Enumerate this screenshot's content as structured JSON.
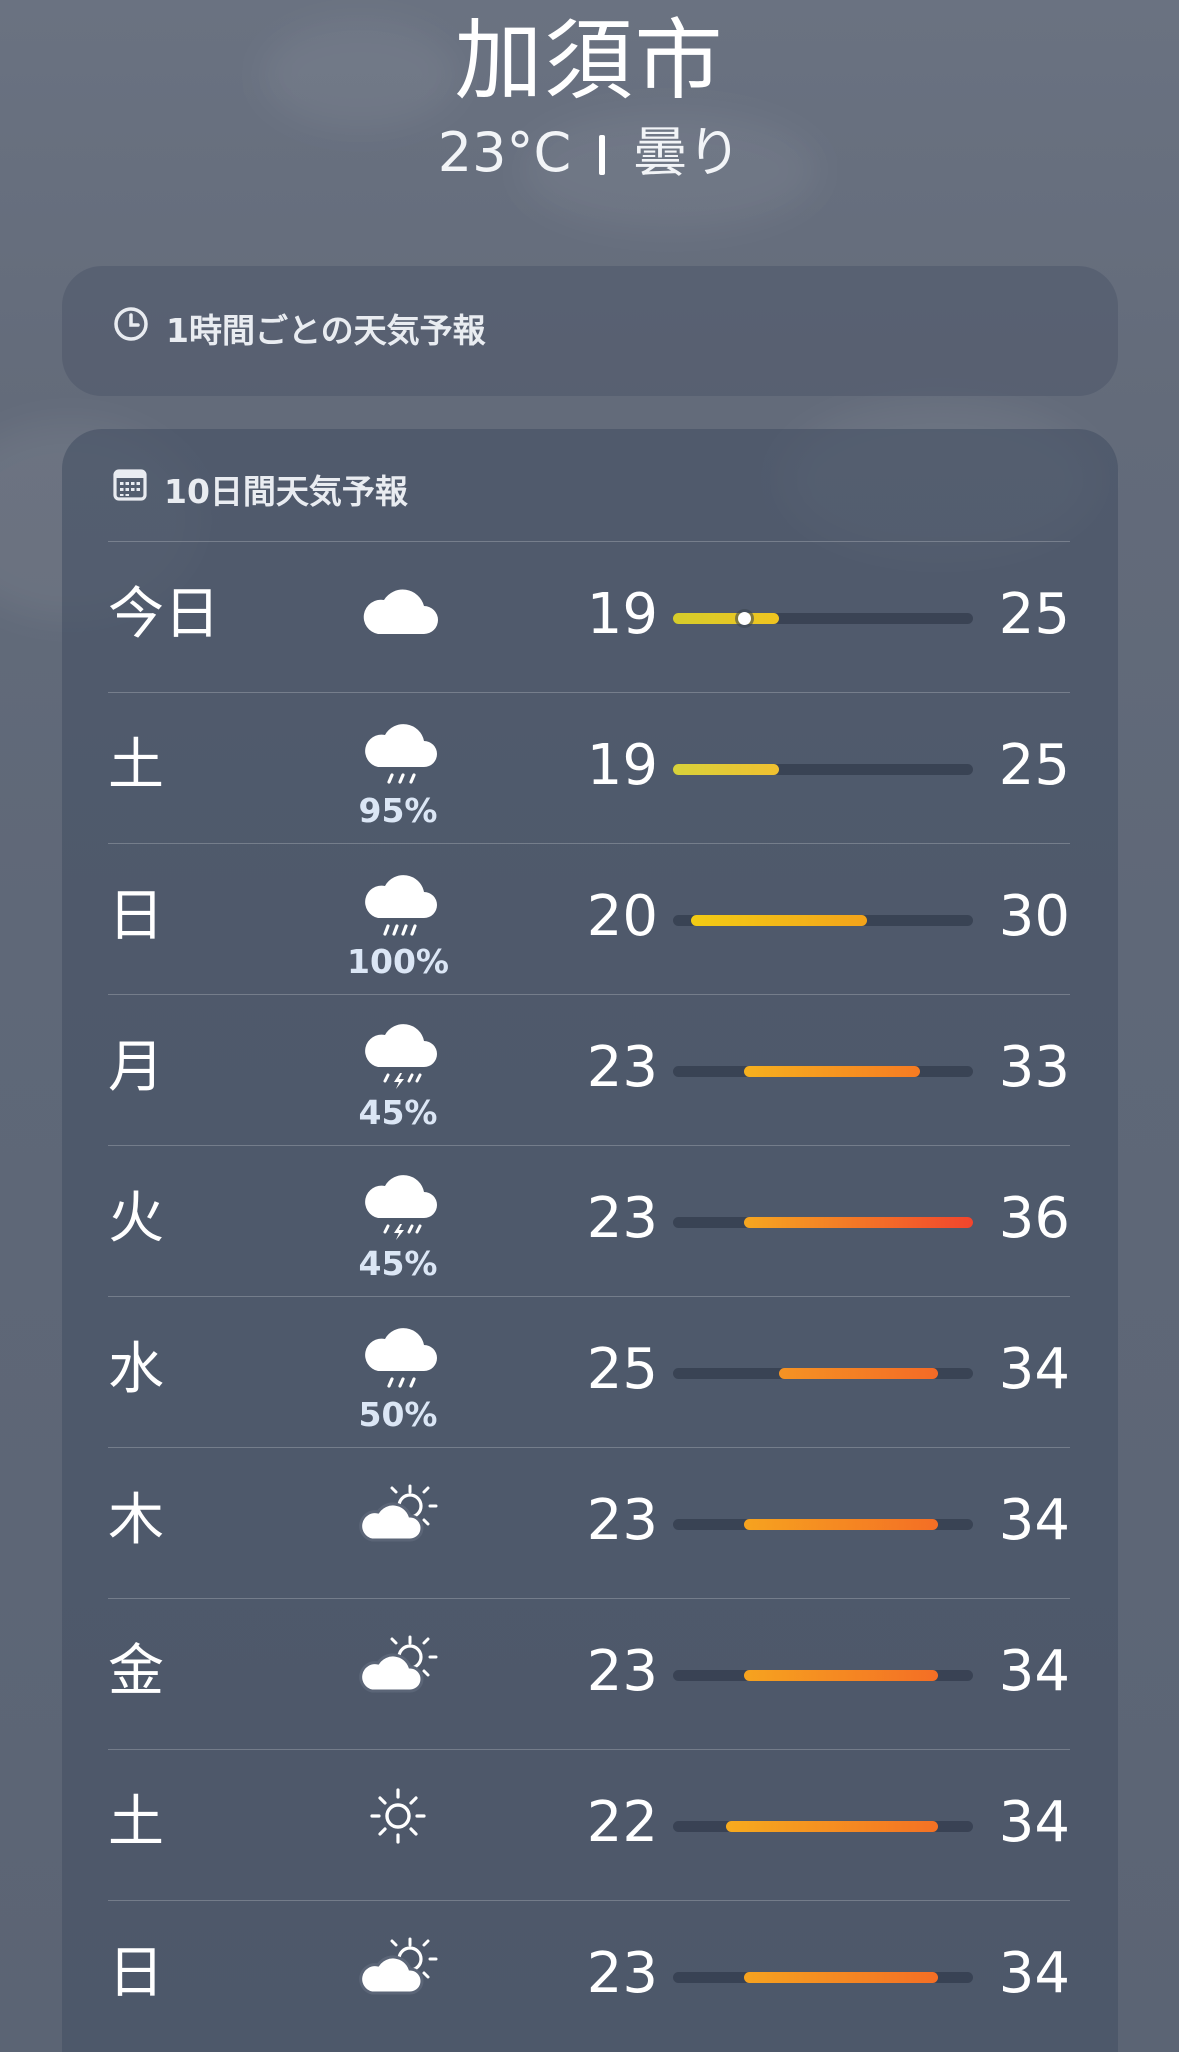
{
  "header": {
    "city": "加須市",
    "temp": "23°C",
    "condition": "曇り"
  },
  "hourly": {
    "title": "1時間ごとの天気予報"
  },
  "daily": {
    "title": "10日間天気予報",
    "range_min": 19,
    "range_max": 36,
    "days": [
      {
        "day": "今日",
        "icon": "cloud-icon",
        "precip": "",
        "low": "19",
        "high": "25",
        "lo": 19,
        "hi": 25,
        "current": 23,
        "colors": [
          "#d6cd2b",
          "#f0c420"
        ]
      },
      {
        "day": "土",
        "icon": "cloud-rain-icon",
        "precip": "95%",
        "low": "19",
        "high": "25",
        "lo": 19,
        "hi": 25,
        "colors": [
          "#d8d23a",
          "#f0c030"
        ]
      },
      {
        "day": "日",
        "icon": "cloud-heavy-rain-icon",
        "precip": "100%",
        "low": "20",
        "high": "30",
        "lo": 20,
        "hi": 30,
        "colors": [
          "#f3cc14",
          "#f3a31a"
        ]
      },
      {
        "day": "月",
        "icon": "cloud-thunderstorm-icon",
        "precip": "45%",
        "low": "23",
        "high": "33",
        "lo": 23,
        "hi": 33,
        "colors": [
          "#f6b11e",
          "#f67b22"
        ]
      },
      {
        "day": "火",
        "icon": "cloud-thunderstorm-icon",
        "precip": "45%",
        "low": "23",
        "high": "36",
        "lo": 23,
        "hi": 36,
        "colors": [
          "#f6a720",
          "#f2452d"
        ]
      },
      {
        "day": "水",
        "icon": "cloud-rain-icon",
        "precip": "50%",
        "low": "25",
        "high": "34",
        "lo": 25,
        "hi": 34,
        "colors": [
          "#f59323",
          "#f46a26"
        ]
      },
      {
        "day": "木",
        "icon": "partly-cloudy-icon",
        "precip": "",
        "low": "23",
        "high": "34",
        "lo": 23,
        "hi": 34,
        "colors": [
          "#f6a31f",
          "#f46e25"
        ]
      },
      {
        "day": "金",
        "icon": "partly-cloudy-icon",
        "precip": "",
        "low": "23",
        "high": "34",
        "lo": 23,
        "hi": 34,
        "colors": [
          "#f6a31f",
          "#f46e25"
        ]
      },
      {
        "day": "土",
        "icon": "sun-icon",
        "precip": "",
        "low": "22",
        "high": "34",
        "lo": 22,
        "hi": 34,
        "colors": [
          "#f7ab1e",
          "#f47124"
        ]
      },
      {
        "day": "日",
        "icon": "partly-cloudy-icon",
        "precip": "",
        "low": "23",
        "high": "34",
        "lo": 23,
        "hi": 34,
        "colors": [
          "#f6a31f",
          "#f46e25"
        ]
      }
    ]
  }
}
